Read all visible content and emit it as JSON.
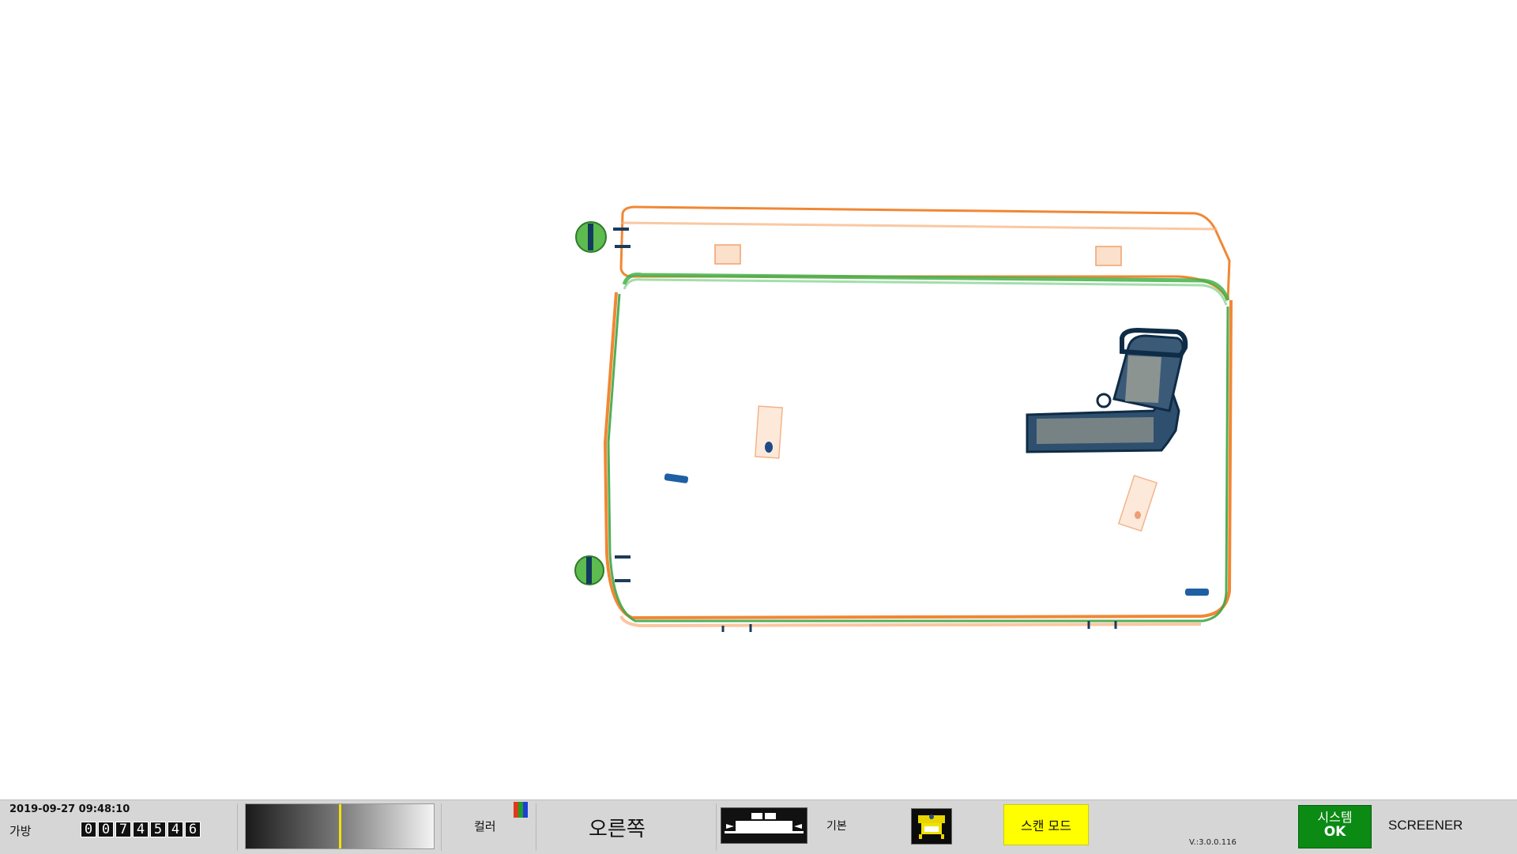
{
  "scan": {
    "image_name": "xray-luggage-image"
  },
  "status_bar": {
    "datetime": "2019-09-27 09:48:10",
    "bag_label": "가방",
    "bag_counter": [
      "0",
      "0",
      "7",
      "4",
      "5",
      "4",
      "6"
    ],
    "density_level": 0.5,
    "color_label": "컬러",
    "color_icon_colors": [
      "#e03a1e",
      "#1f9e2b",
      "#1e3fd6"
    ],
    "direction_label": "오른쪽",
    "conveyor_icon": "conveyor-belt-icon",
    "mode_label": "기본",
    "enhance_icon": "image-enhance-icon",
    "scan_mode_label": "스캔 모드",
    "version": "V.:3.0.0.116",
    "system_label": "시스템",
    "system_status": "OK",
    "operator_label": "SCREENER"
  },
  "colors": {
    "statusbar_bg": "#d6d6d6",
    "scan_mode_bg": "#ffff00",
    "system_ok_bg": "#0b8a14",
    "density_marker": "#f5e300"
  }
}
